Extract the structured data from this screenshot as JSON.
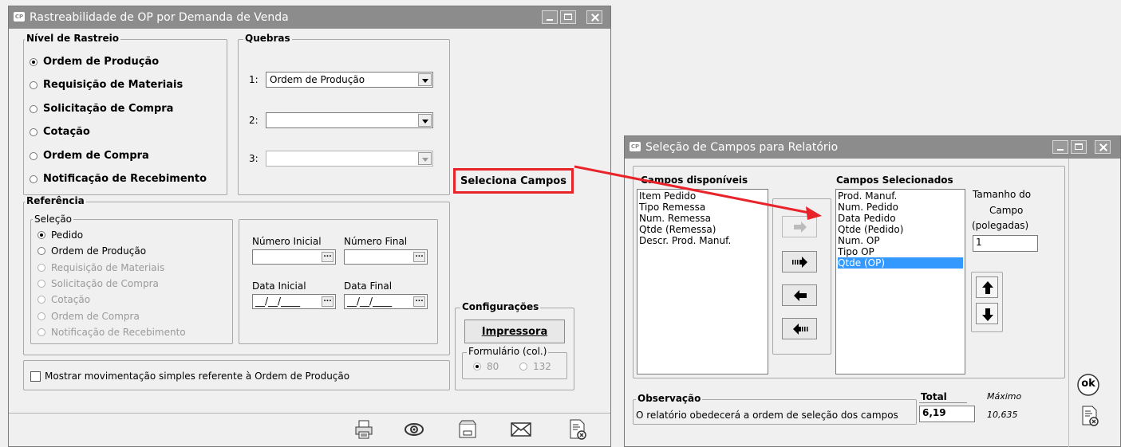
{
  "window1": {
    "title": "Rastreabilidade de OP por Demanda de Venda",
    "app_icon": "CP",
    "nivel": {
      "legend": "Nível de Rastreio",
      "options": [
        "Ordem de Produção",
        "Requisição de Materiais",
        "Solicitação de Compra",
        "Cotação",
        "Ordem de Compra",
        "Notificação de Recebimento"
      ],
      "selected": 0
    },
    "quebras": {
      "legend": "Quebras",
      "rows": [
        {
          "num": "1:",
          "value": "Ordem de Produção",
          "enabled": true
        },
        {
          "num": "2:",
          "value": "",
          "enabled": true
        },
        {
          "num": "3:",
          "value": "",
          "enabled": false
        }
      ]
    },
    "seleciona_button": "Seleciona Campos",
    "referencia": {
      "legend": "Referência",
      "selecao_legend": "Seleção",
      "options": [
        {
          "label": "Pedido",
          "enabled": true,
          "selected": true
        },
        {
          "label": "Ordem de Produção",
          "enabled": true,
          "selected": false
        },
        {
          "label": "Requisição de Materiais",
          "enabled": false,
          "selected": false
        },
        {
          "label": "Solicitação de Compra",
          "enabled": false,
          "selected": false
        },
        {
          "label": "Cotação",
          "enabled": false,
          "selected": false
        },
        {
          "label": "Ordem de Compra",
          "enabled": false,
          "selected": false
        },
        {
          "label": "Notificação de Recebimento",
          "enabled": false,
          "selected": false
        }
      ],
      "numero_inicial_label": "Número Inicial",
      "numero_final_label": "Número Final",
      "data_inicial_label": "Data Inicial",
      "data_final_label": "Data Final",
      "data_inicial_value": "__/__/____",
      "data_final_value": "__/__/____",
      "ellipsis": "..."
    },
    "config": {
      "legend": "Configurações",
      "printer_button": "Impressora",
      "formulario_legend": "Formulário (col.)",
      "option_80": "80",
      "option_132": "132"
    },
    "checkbox_label": "Mostrar movimentação simples referente à Ordem de Produção",
    "toolbar_icons": [
      "printer-icon",
      "preview-eye-icon",
      "disk-icon",
      "email-icon",
      "close-document-icon"
    ]
  },
  "window2": {
    "title": "Seleção de Campos para Relatório",
    "app_icon": "CP",
    "disponiveis_label": "Campos disponíveis",
    "disponiveis": [
      "Item Pedido",
      "Tipo Remessa",
      "Num. Remessa",
      "Qtde (Remessa)",
      "Descr. Prod. Manuf."
    ],
    "selecionados_label": "Campos Selecionados",
    "selecionados": [
      "Prod. Manuf.",
      "Num. Pedido",
      "Data Pedido",
      "Qtde (Pedido)",
      "Num. OP",
      "Tipo OP",
      "Qtde (OP)"
    ],
    "selected_index": 6,
    "tamanho_label": [
      "Tamanho do",
      "Campo",
      "(polegadas)"
    ],
    "tamanho_value": "1",
    "observacao_legend": "Observação",
    "observacao_text": "O relatório obedecerá a ordem de seleção dos campos",
    "total_label": "Total",
    "total_value": "6,19",
    "maximo_label": "Máximo",
    "maximo_value": "10,635",
    "ok_label": "ok"
  },
  "colors": {
    "highlight": "#e8242a",
    "selection": "#3399ff",
    "titlebar": "#8c8c8c"
  }
}
